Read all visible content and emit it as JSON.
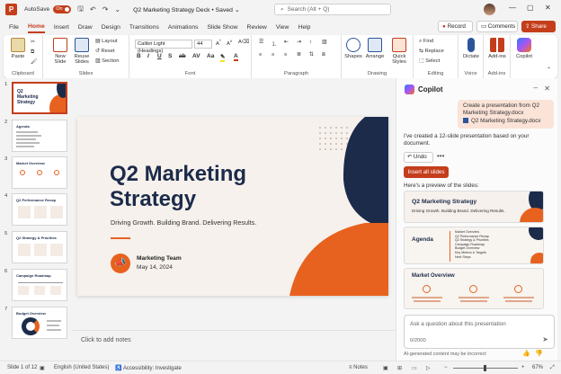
{
  "titlebar": {
    "app_letter": "P",
    "autosave_label": "AutoSave",
    "autosave_state": "On",
    "doc_title": "Q2 Marketing Strategy Deck  •  Saved  ⌄",
    "search_placeholder": "Search (Alt + Q)"
  },
  "menu": {
    "tabs": [
      "File",
      "Home",
      "Insert",
      "Draw",
      "Design",
      "Transitions",
      "Animations",
      "Slide Show",
      "Review",
      "View",
      "Help"
    ],
    "active": "Home",
    "record_label": "Record",
    "comments_label": "Comments",
    "share_label": "Share"
  },
  "ribbon": {
    "clipboard": {
      "paste": "Paste",
      "label": "Clipboard"
    },
    "slides": {
      "new_slide": "New Slide",
      "reuse_slides": "Reuse Slides",
      "layout": "Layout",
      "reset": "Reset",
      "section": "Section",
      "label": "Slides"
    },
    "font": {
      "font_name": "Calibri Light (Headings)",
      "font_size": "44",
      "label": "Font"
    },
    "paragraph": {
      "label": "Paragraph"
    },
    "drawing": {
      "shapes": "Shapes",
      "arrange": "Arrange",
      "quick_styles": "Quick Styles",
      "label": "Drawing"
    },
    "editing": {
      "find": "Find",
      "replace": "Replace",
      "select": "Select",
      "label": "Editing"
    },
    "voice": {
      "dictate": "Dictate",
      "label": "Voice"
    },
    "addins": {
      "addins": "Add-ins",
      "label": "Add-ins"
    },
    "copilot": {
      "label": "Copilot"
    }
  },
  "thumbnails": [
    {
      "num": "1",
      "title": "Q2 Marketing Strategy"
    },
    {
      "num": "2",
      "title": "Agenda"
    },
    {
      "num": "3",
      "title": "Market Overview"
    },
    {
      "num": "4",
      "title": "Q2 Performance Recap"
    },
    {
      "num": "5",
      "title": "Q2 Strategy & Priorities"
    },
    {
      "num": "6",
      "title": "Campaign Roadmap"
    },
    {
      "num": "7",
      "title": "Budget Overview"
    }
  ],
  "slide": {
    "title_line1": "Q2 Marketing",
    "title_line2": "Strategy",
    "subtitle": "Driving Growth. Building Brand. Delivering Results.",
    "team": "Marketing Team",
    "date": "May 14, 2024",
    "accent": "#e8621f",
    "navy": "#1c2b4a"
  },
  "notes_placeholder": "Click to add notes",
  "copilot": {
    "title": "Copilot",
    "user_message": "Create a presentation from Q2 Marketing Strategy.docx",
    "user_file": "Q2 Marketing Strategy.docx",
    "reply": "I've created a 12-slide presentation based on your document.",
    "undo_label": "Undo",
    "insert_label": "Insert all slides",
    "preview_label": "Here's a preview of the slides:",
    "preview1": {
      "title": "Q2 Marketing Strategy",
      "subtitle": "Driving Growth. Building Brand. Delivering Results."
    },
    "preview2": {
      "title": "Agenda",
      "items": [
        "Market Overview",
        "Q2 Performance Recap",
        "Q2 Strategy & Priorities",
        "Campaign Roadmap",
        "Budget Overview",
        "Key Metrics & Targets",
        "Next Steps"
      ]
    },
    "preview3": {
      "title": "Market Overview"
    },
    "ask_placeholder": "Ask a question about this presentation",
    "char_count": "0/2000",
    "disclaimer": "AI-generated content may be incorrect"
  },
  "status": {
    "slide_pos": "Slide 1 of 12",
    "language": "English (United States)",
    "accessibility": "Accessibility: Investigate",
    "notes": "Notes",
    "zoom": "67%"
  }
}
